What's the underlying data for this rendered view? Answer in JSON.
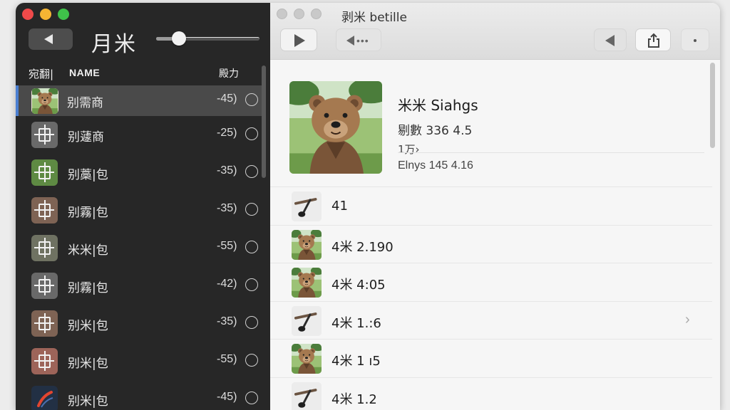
{
  "window": {
    "title": "剥米 betille"
  },
  "sidebar": {
    "title": "月米",
    "volume": 0.22,
    "columns": {
      "select": "宛翻|",
      "name": "NAME",
      "duration": "殿力"
    },
    "items": [
      {
        "label": "别需商",
        "duration": "-45)",
        "art": "bear",
        "selected": true
      },
      {
        "label": "别蘧商",
        "duration": "-25)",
        "art": "gray"
      },
      {
        "label": "别藁|包",
        "duration": "-35)",
        "art": "green"
      },
      {
        "label": "别霧|包",
        "duration": "-35)",
        "art": "brown"
      },
      {
        "label": "米米|包",
        "duration": "-55)",
        "art": "olive"
      },
      {
        "label": "别霧|包",
        "duration": "-42)",
        "art": "gray"
      },
      {
        "label": "别米|包",
        "duration": "-35)",
        "art": "brown"
      },
      {
        "label": "别米|包",
        "duration": "-55)",
        "art": "red"
      },
      {
        "label": "别米|包",
        "duration": "-45)",
        "art": "dark"
      }
    ]
  },
  "detail": {
    "title": "米米 Siahgs",
    "subtitle": "剔數  336  4.5",
    "count": "1万›",
    "meta": "Elnys 145 4.16",
    "tracks": [
      {
        "label": "41",
        "art": "guitar"
      },
      {
        "label": "4米 2.190",
        "art": "bear"
      },
      {
        "label": "4米 4:05",
        "art": "bear"
      },
      {
        "label": "4米 1.:6",
        "art": "guitar",
        "chevron": "›"
      },
      {
        "label": "4米 1 ı5",
        "art": "bear"
      },
      {
        "label": "4米 1.2",
        "art": "guitar"
      }
    ]
  },
  "colors": {
    "sidebar_bg": "#272727",
    "selection": "#4a4a4a",
    "accent": "#4a7fd2"
  }
}
